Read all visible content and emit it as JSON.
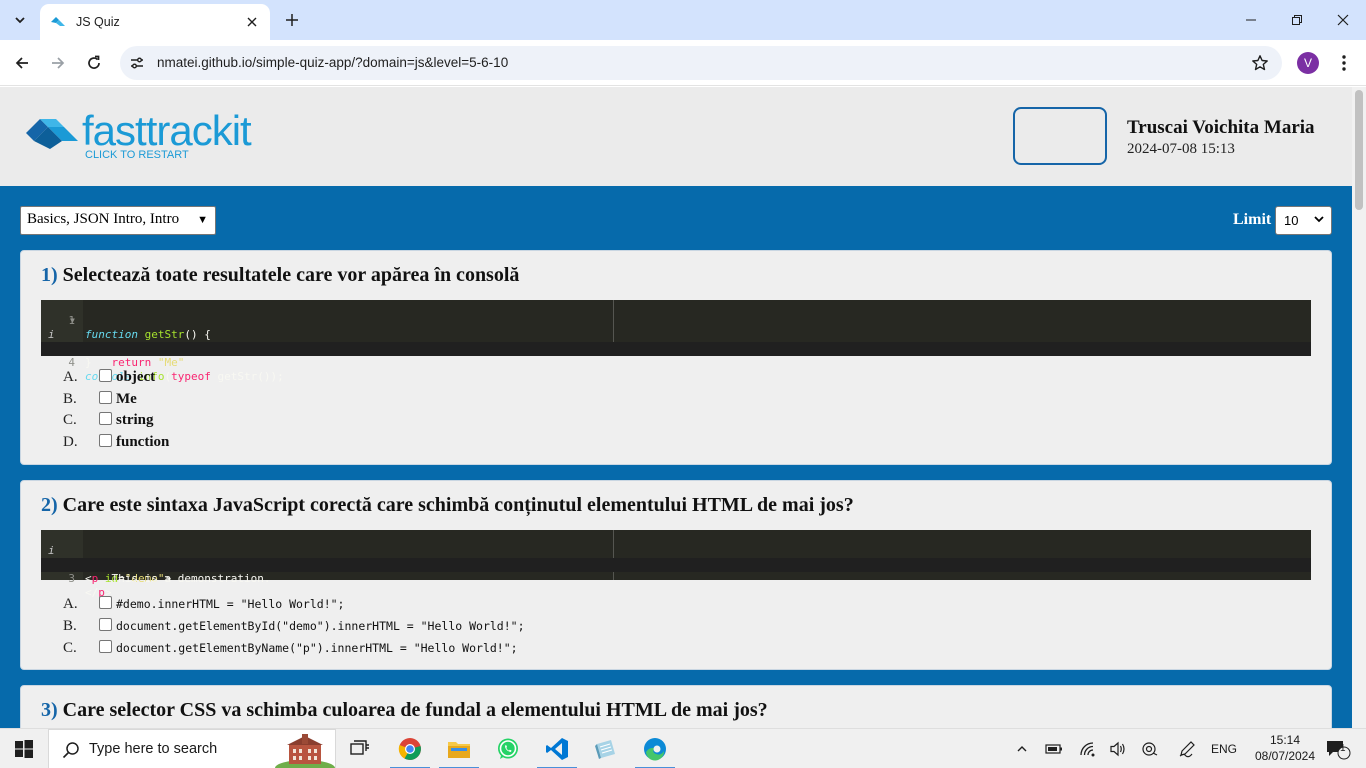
{
  "browser": {
    "tab_title": "JS Quiz",
    "url": "nmatei.github.io/simple-quiz-app/?domain=js&level=5-6-10",
    "profile_initial": "V",
    "colors": {
      "tabbar": "#d3e3fd",
      "profile": "#7b2fa3"
    }
  },
  "header": {
    "logo_text": "fasttrackit",
    "logo_subtext": "CLICK TO RESTART",
    "user_name": "Truscai Voichita Maria",
    "user_date": "2024-07-08 15:13"
  },
  "controls": {
    "domain_selected": "Basics, JSON Intro, Intro",
    "limit_label": "Limit",
    "limit_selected": "10"
  },
  "questions": [
    {
      "number": "1)",
      "text": "Selectează toate resultatele care vor apărea în consolă",
      "code_line_numbers": [
        "1",
        "2",
        "3",
        "4"
      ],
      "answers": [
        {
          "letter": "A.",
          "text": "object"
        },
        {
          "letter": "B.",
          "text": "Me"
        },
        {
          "letter": "C.",
          "text": "string"
        },
        {
          "letter": "D.",
          "text": "function"
        }
      ]
    },
    {
      "number": "2)",
      "text": "Care este sintaxa JavaScript corectă care schimbă conținutul elementului HTML de mai jos?",
      "code_line_numbers": [
        "1",
        "2",
        "3"
      ],
      "answers": [
        {
          "letter": "A.",
          "text": "#demo.innerHTML = \"Hello World!\";"
        },
        {
          "letter": "B.",
          "text": "document.getElementById(\"demo\").innerHTML = \"Hello World!\";"
        },
        {
          "letter": "C.",
          "text": "document.getElementByName(\"p\").innerHTML = \"Hello World!\";"
        }
      ]
    },
    {
      "number": "3)",
      "text": "Care selector CSS va schimba culoarea de fundal a elementului HTML de mai jos?"
    }
  ],
  "code1": {
    "l1_kw": "function",
    "l1_fn": "getStr",
    "l1_rest": "() {",
    "l2_kw": "return",
    "l2_str": "\"Me\"",
    "l3": "}",
    "l4_obj": "console",
    "l4_fn": ".info",
    "l4_p": "(",
    "l4_kw": "typeof",
    "l4_rest": " getStr());"
  },
  "code2": {
    "l1_open": "<",
    "l1_tag": "p",
    "l1_attr": "id",
    "l1_eq": "=",
    "l1_str": "\"demo\"",
    "l1_close": ">",
    "l2": "This is a demonstration.",
    "l3_open": "</",
    "l3_tag": "p",
    "l3_close": ">"
  },
  "taskbar": {
    "search_placeholder": "Type here to search",
    "language": "ENG",
    "time": "15:14",
    "date": "08/07/2024",
    "notification_count": "1"
  },
  "theme": {
    "page_blue": "#066aab",
    "card_bg": "#efefef",
    "question_number": "#1565a8",
    "editor_bg": "#272822"
  }
}
